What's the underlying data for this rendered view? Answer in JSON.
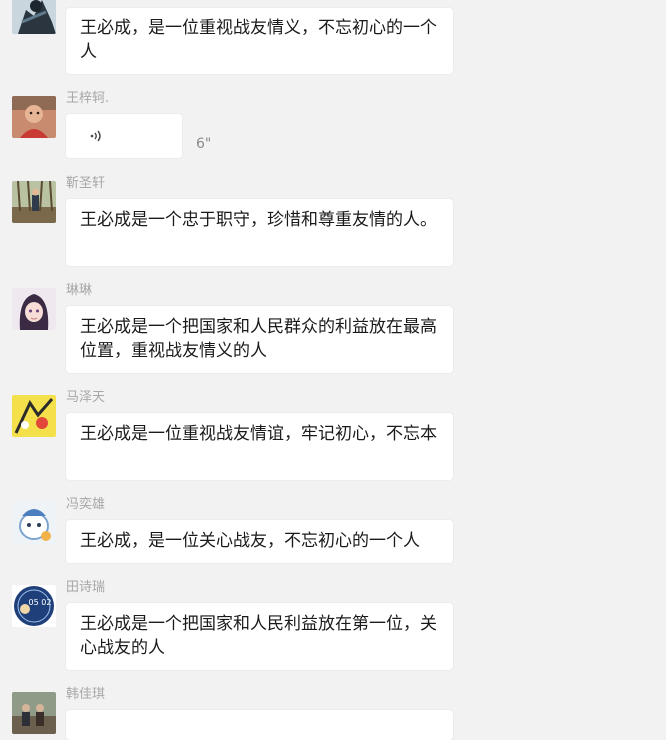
{
  "messages": [
    {
      "sender": "",
      "text": "王必成，是一位重视战友情义，不忘初心的一个人",
      "avatar_icon": "avatar-dark-figure-icon"
    },
    {
      "sender": "王梓轲.",
      "voice_duration": "6\"",
      "avatar_icon": "avatar-child-photo-icon"
    },
    {
      "sender": "靳圣轩",
      "text": "王必成是一个忠于职守，珍惜和尊重友情的人。",
      "avatar_icon": "avatar-outdoor-photo-icon"
    },
    {
      "sender": "琳琳",
      "text": "王必成是一个把国家和人民群众的利益放在最高位置，重视战友情义的人",
      "avatar_icon": "avatar-anime-girl-icon"
    },
    {
      "sender": "马泽天",
      "text": "王必成是一位重视战友情谊，牢记初心，不忘本",
      "avatar_icon": "avatar-yellow-cartoon-icon"
    },
    {
      "sender": "冯奕雄",
      "text": "王必成，是一位关心战友，不忘初心的一个人",
      "avatar_icon": "avatar-blue-cartoon-icon"
    },
    {
      "sender": "田诗瑞",
      "text": "王必成是一个把国家和人民利益放在第一位，关心战友的人",
      "avatar_icon": "avatar-blue-circle-badge-icon",
      "avatar_badge_text": "05 02"
    },
    {
      "sender": "韩佳琪",
      "text": "",
      "avatar_icon": "avatar-group-photo-icon"
    }
  ]
}
